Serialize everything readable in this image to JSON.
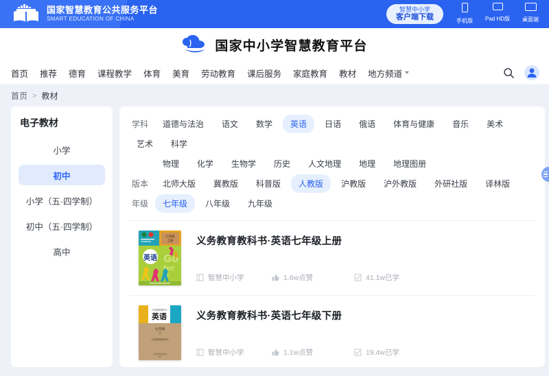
{
  "topbar": {
    "brand_cn": "国家智慧教育公共服务平台",
    "brand_en": "SMART EDUCATION OF CHINA",
    "logo_icon": "book-platform-logo",
    "download_line1": "智慧中小学",
    "download_line2": "客户端下载",
    "devices": [
      {
        "icon": "phone-icon",
        "label": "手机版"
      },
      {
        "icon": "tablet-icon",
        "label": "Pad HD版"
      },
      {
        "icon": "desktop-icon",
        "label": "桌面端"
      }
    ]
  },
  "logobar": {
    "icon": "cloud-book-icon",
    "title": "国家中小学智慧教育平台"
  },
  "nav": {
    "items": [
      {
        "label": "首页"
      },
      {
        "label": "推荐"
      },
      {
        "label": "德育"
      },
      {
        "label": "课程教学"
      },
      {
        "label": "体育"
      },
      {
        "label": "美育"
      },
      {
        "label": "劳动教育"
      },
      {
        "label": "课后服务"
      },
      {
        "label": "家庭教育"
      },
      {
        "label": "教材"
      },
      {
        "label": "地方频道",
        "caret": true
      }
    ],
    "search_icon": "search-icon",
    "avatar_icon": "user-avatar-icon"
  },
  "breadcrumb": {
    "home": "首页",
    "separator": ">",
    "current": "教材"
  },
  "sidebar": {
    "title": "电子教材",
    "items": [
      {
        "label": "小学",
        "active": false
      },
      {
        "label": "初中",
        "active": true
      },
      {
        "label": "小学（五·四学制）",
        "active": false
      },
      {
        "label": "初中（五·四学制）",
        "active": false
      },
      {
        "label": "高中",
        "active": false
      }
    ]
  },
  "filters": [
    {
      "label": "学科",
      "chips": [
        "道德与法治",
        "语文",
        "数学",
        "英语",
        "日语",
        "俄语",
        "体育与健康",
        "音乐",
        "美术",
        "艺术",
        "科学"
      ],
      "active": "英语"
    },
    {
      "label": "",
      "chips": [
        "物理",
        "化学",
        "生物学",
        "历史",
        "人文地理",
        "地理",
        "地理图册"
      ],
      "active": ""
    },
    {
      "label": "版本",
      "chips": [
        "北师大版",
        "冀教版",
        "科普版",
        "人教版",
        "沪教版",
        "沪外教版",
        "外研社版",
        "译林版"
      ],
      "active": "人教版"
    },
    {
      "label": "年级",
      "chips": [
        "七年级",
        "八年级",
        "九年级"
      ],
      "active": "七年级"
    }
  ],
  "books": [
    {
      "title": "义务教育教科书·英语七年级上册",
      "cover": "english-grade7-vol1-cover",
      "publisher_icon": "book-icon",
      "publisher": "智慧中小学",
      "like_icon": "thumbs-up-icon",
      "likes": "1.6w点赞",
      "study_icon": "study-icon",
      "studied": "41.1w已学"
    },
    {
      "title": "义务教育教科书·英语七年级下册",
      "cover": "english-grade7-vol2-cover",
      "publisher_icon": "book-icon",
      "publisher": "智慧中小学",
      "like_icon": "thumbs-up-icon",
      "likes": "1.1w点赞",
      "study_icon": "study-icon",
      "studied": "19.4w已学"
    }
  ],
  "float_tab": {
    "icon": "feedback-tab-icon"
  },
  "colors": {
    "brand_blue": "#2a63f0",
    "chip_active_bg": "#e6effd",
    "sidebar_active_bg": "#e2ebfd",
    "page_bg": "#eef1f8"
  }
}
